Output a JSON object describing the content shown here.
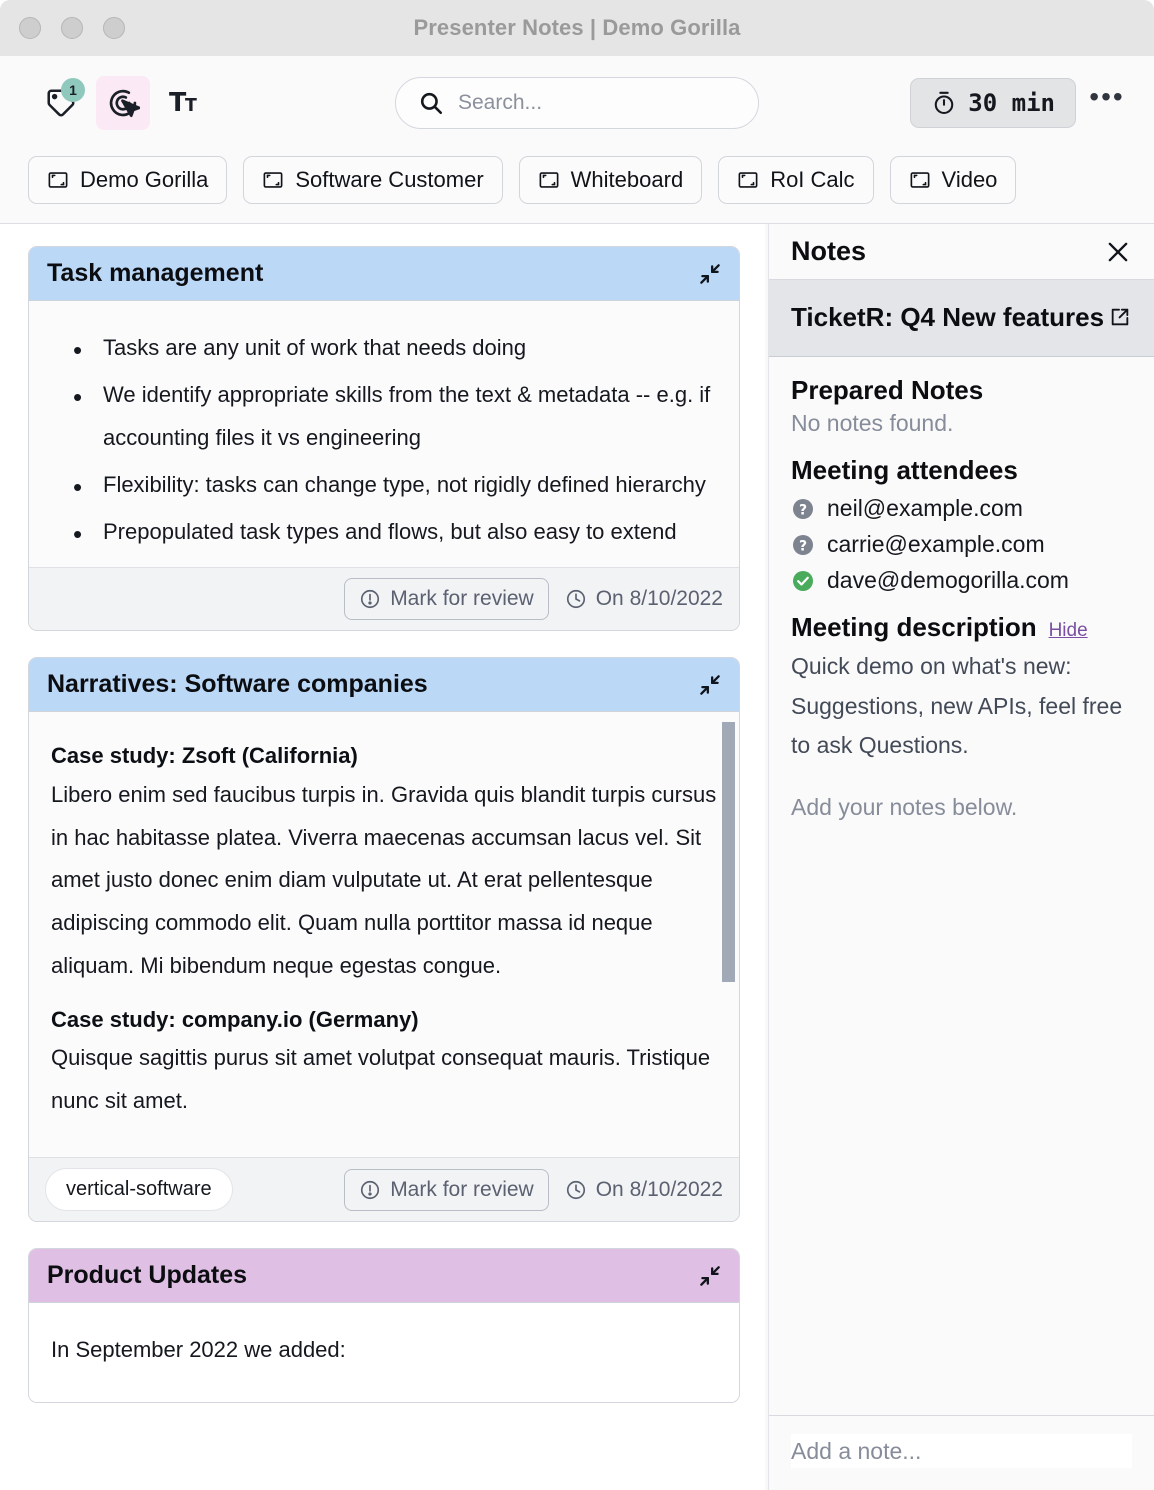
{
  "window": {
    "title": "Presenter Notes | Demo Gorilla",
    "traffic_lights": [
      "close",
      "minimize",
      "maximize"
    ]
  },
  "toolbar": {
    "icons": [
      {
        "name": "tag-icon",
        "badge": "1",
        "active": false
      },
      {
        "name": "cursor-target-icon",
        "badge": "",
        "active": true
      },
      {
        "name": "text-size-icon",
        "badge": "",
        "active": false
      }
    ],
    "search": {
      "placeholder": "Search...",
      "value": ""
    },
    "timer_label": "30 min",
    "more_label": "•••"
  },
  "tabs": [
    {
      "label": "Demo Gorilla"
    },
    {
      "label": "Software Customer"
    },
    {
      "label": "Whiteboard"
    },
    {
      "label": "RoI Calc"
    },
    {
      "label": "Video"
    }
  ],
  "cards": [
    {
      "title": "Task management",
      "accent": "#bcd8f7",
      "bullets": [
        "Tasks are any unit of work that needs doing",
        "We identify appropriate skills from the text & metadata -- e.g. if accounting files it vs engineering",
        "Flexibility: tasks can change type, not rigidly defined hierarchy",
        "Prepopulated task types and flows, but also easy to extend"
      ],
      "tag": "",
      "review_label": "Mark for review",
      "date_label": "On 8/10/2022"
    },
    {
      "title": "Narratives: Software companies",
      "accent": "#bcd8f7",
      "sections": [
        {
          "heading": "Case study: Zsoft (California)",
          "text": "Libero enim sed faucibus turpis in. Gravida quis blandit turpis cursus in hac habitasse platea. Viverra maecenas accumsan lacus vel. Sit amet justo donec enim diam vulputate ut. At erat pellentesque adipiscing commodo elit. Quam nulla porttitor massa id neque aliquam. Mi bibendum neque egestas congue."
        },
        {
          "heading": "Case study: company.io (Germany)",
          "text": "Quisque sagittis purus sit amet volutpat consequat mauris. Tristique nunc sit amet."
        }
      ],
      "tag": "vertical-software",
      "review_label": "Mark for review",
      "date_label": "On 8/10/2022"
    },
    {
      "title": "Product Updates",
      "accent": "#dfbfe4",
      "intro": "In September 2022 we added:"
    }
  ],
  "notes_panel": {
    "header_title": "Notes",
    "meeting_title": "TicketR: Q4 New features",
    "prepared_notes_title": "Prepared Notes",
    "prepared_notes_empty": "No notes found.",
    "attendees_title": "Meeting attendees",
    "attendees": [
      {
        "email": "neil@example.com",
        "status": "unknown"
      },
      {
        "email": "carrie@example.com",
        "status": "unknown"
      },
      {
        "email": "dave@demogorilla.com",
        "status": "accepted"
      }
    ],
    "description_title": "Meeting description",
    "hide_label": "Hide",
    "description_text": "Quick demo on what's new: Suggestions, new APIs, feel free to ask Questions.",
    "add_notes_hint": "Add your notes below.",
    "note_placeholder": "Add a note..."
  },
  "colors": {
    "accent_blue": "#bcd8f7",
    "accent_purple": "#dfbfe4",
    "badge_teal": "#8fc9bd",
    "active_pink": "#fbe9f5",
    "link_purple": "#7a4fa3",
    "status_green": "#4aab5c",
    "status_gray": "#7d838f"
  }
}
